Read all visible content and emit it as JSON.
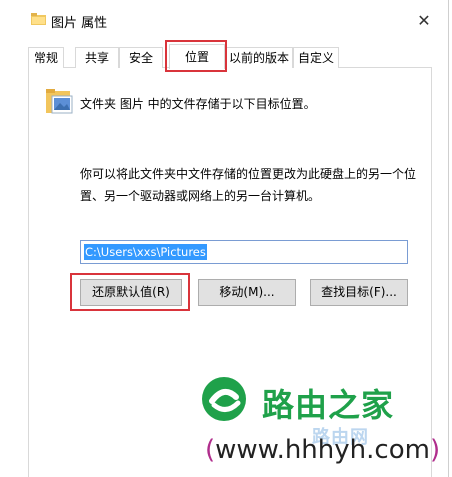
{
  "window": {
    "title": "图片 属性",
    "close_glyph": "✕"
  },
  "tabs": [
    {
      "label": "常规"
    },
    {
      "label": "共享"
    },
    {
      "label": "安全"
    },
    {
      "label": "位置",
      "active": true
    },
    {
      "label": "以前的版本"
    },
    {
      "label": "自定义"
    }
  ],
  "location": {
    "description": "文件夹 图片 中的文件存储于以下目标位置。",
    "explanation": "你可以将此文件夹中文件存储的位置更改为此硬盘上的另一个位置、另一个驱动器或网络上的另一台计算机。",
    "path_value": "C:\\Users\\xxs\\Pictures"
  },
  "buttons": {
    "restore_default": "还原默认值(R)",
    "move": "移动(M)...",
    "find_target": "查找目标(F)..."
  },
  "watermark": {
    "brand": "路由之家",
    "sub": "路由网",
    "url_open": "(",
    "url": "www.hhhyh.com",
    "url_close": ")"
  },
  "colors": {
    "highlight": "#d9343b",
    "selection": "#3399ff",
    "logo_green": "#1fa14a",
    "url_paren": "#b02d8c"
  },
  "icons": {
    "title_icon": "folder-icon",
    "content_icon": "pictures-folder-icon",
    "close": "close-icon",
    "logo": "router-home-logo-icon"
  }
}
